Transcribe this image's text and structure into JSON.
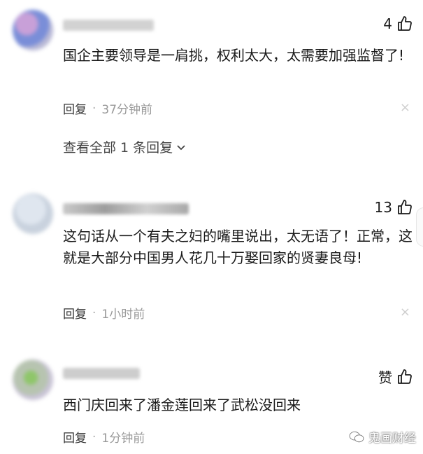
{
  "colors": {
    "text": "#1a1a1a",
    "muted": "#999999",
    "reply": "#333333"
  },
  "comments": [
    {
      "likes": "4",
      "text": "国企主要领导是一肩挑，权利太大，太需要加强监督了!",
      "reply_label": "回复",
      "separator": "·",
      "time": "37分钟前",
      "close": "×",
      "expand_label": "查看全部 1 条回复"
    },
    {
      "likes": "13",
      "text": "这句话从一个有夫之妇的嘴里说出，太无语了！正常，这就是大部分中国男人花几十万娶回家的贤妻良母!",
      "reply_label": "回复",
      "separator": "·",
      "time": "1小时前",
      "close": "×"
    },
    {
      "likes": "赞",
      "text": "西门庆回来了潘金莲回来了武松没回来",
      "reply_label": "回复",
      "separator": "·",
      "time": "1分钟前"
    }
  ],
  "watermark": {
    "text": "鬼画财经",
    "icon": "wechat-icon"
  }
}
